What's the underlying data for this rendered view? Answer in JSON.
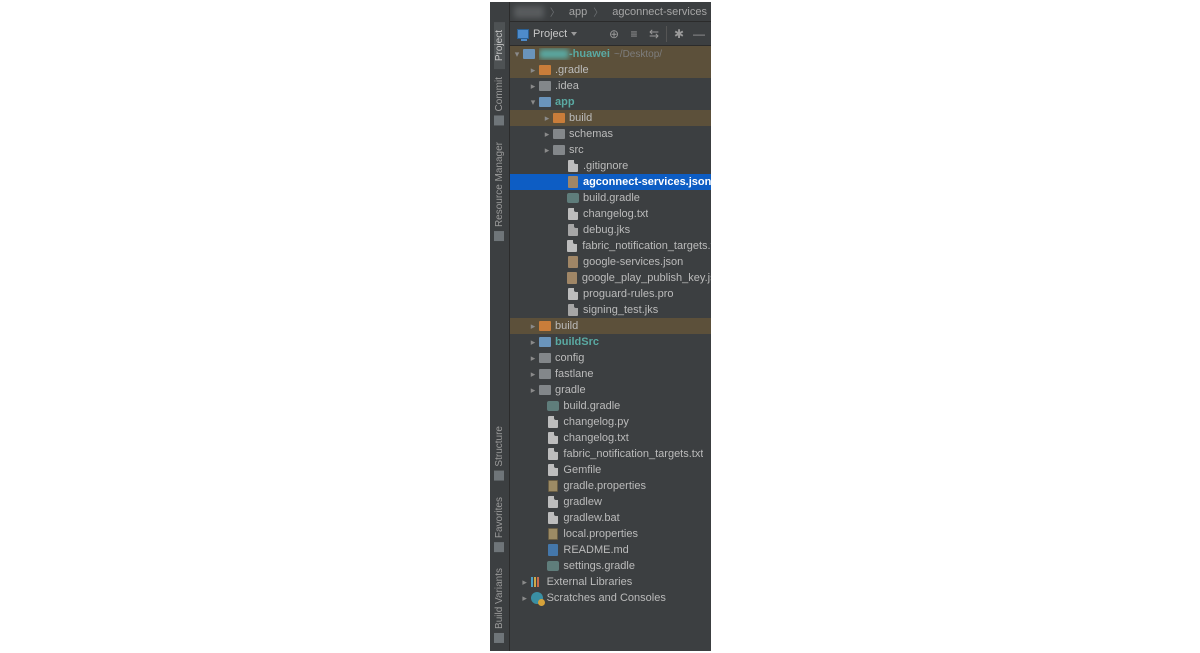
{
  "breadcrumb": {
    "items": [
      {
        "blurred": true,
        "label": ""
      },
      {
        "label": "app",
        "icon": "folder"
      },
      {
        "label": "agconnect-services",
        "icon": "json"
      }
    ]
  },
  "toolbar": {
    "selector_label": "Project"
  },
  "tree": {
    "root": {
      "label_blur": true,
      "suffix": "-huawei",
      "hint": "~/Desktop/"
    },
    "nodes": [
      {
        "depth": 1,
        "arrow": "right",
        "icon": "fold-orange",
        "label": ".gradle",
        "hl": "brown"
      },
      {
        "depth": 1,
        "arrow": "right",
        "icon": "fold-grey",
        "label": ".idea"
      },
      {
        "depth": 1,
        "arrow": "down",
        "icon": "fold-blue",
        "label": "app",
        "bold": true,
        "teal": true
      },
      {
        "depth": 2,
        "arrow": "right",
        "icon": "fold-orange",
        "label": "build",
        "hl": "brown"
      },
      {
        "depth": 2,
        "arrow": "right",
        "icon": "fold-grey",
        "label": "schemas"
      },
      {
        "depth": 2,
        "arrow": "right",
        "icon": "fold-grey",
        "label": "src"
      },
      {
        "depth": 3,
        "arrow": "",
        "icon": "file-txt",
        "label": ".gitignore"
      },
      {
        "depth": 3,
        "arrow": "",
        "icon": "json",
        "label": "agconnect-services.json",
        "bold": true,
        "selected": true
      },
      {
        "depth": 3,
        "arrow": "",
        "icon": "gradle",
        "label": "build.gradle"
      },
      {
        "depth": 3,
        "arrow": "",
        "icon": "file-txt",
        "label": "changelog.txt"
      },
      {
        "depth": 3,
        "arrow": "",
        "icon": "file-dark",
        "label": "debug.jks"
      },
      {
        "depth": 3,
        "arrow": "",
        "icon": "file-txt",
        "label": "fabric_notification_targets.txt"
      },
      {
        "depth": 3,
        "arrow": "",
        "icon": "json",
        "label": "google-services.json"
      },
      {
        "depth": 3,
        "arrow": "",
        "icon": "json",
        "label": "google_play_publish_key.json"
      },
      {
        "depth": 3,
        "arrow": "",
        "icon": "file-txt",
        "label": "proguard-rules.pro"
      },
      {
        "depth": 3,
        "arrow": "",
        "icon": "file-dark",
        "label": "signing_test.jks"
      },
      {
        "depth": 1,
        "arrow": "right",
        "icon": "fold-orange",
        "label": "build",
        "hl": "brown"
      },
      {
        "depth": 1,
        "arrow": "right",
        "icon": "fold-blue",
        "label": "buildSrc",
        "bold": true,
        "teal": true
      },
      {
        "depth": 1,
        "arrow": "right",
        "icon": "fold-grey",
        "label": "config"
      },
      {
        "depth": 1,
        "arrow": "right",
        "icon": "fold-grey",
        "label": "fastlane"
      },
      {
        "depth": 1,
        "arrow": "right",
        "icon": "fold-grey",
        "label": "gradle"
      },
      {
        "depth": 2,
        "arrow": "",
        "icon": "gradle",
        "label": "build.gradle",
        "depthOverride": 1.6
      },
      {
        "depth": 2,
        "arrow": "",
        "icon": "file-txt",
        "label": "changelog.py",
        "depthOverride": 1.6
      },
      {
        "depth": 2,
        "arrow": "",
        "icon": "file-txt",
        "label": "changelog.txt",
        "depthOverride": 1.6
      },
      {
        "depth": 2,
        "arrow": "",
        "icon": "file-txt",
        "label": "fabric_notification_targets.txt",
        "depthOverride": 1.6
      },
      {
        "depth": 2,
        "arrow": "",
        "icon": "file-txt",
        "label": "Gemfile",
        "depthOverride": 1.6
      },
      {
        "depth": 2,
        "arrow": "",
        "icon": "prop",
        "label": "gradle.properties",
        "depthOverride": 1.6
      },
      {
        "depth": 2,
        "arrow": "",
        "icon": "file-txt",
        "label": "gradlew",
        "depthOverride": 1.6
      },
      {
        "depth": 2,
        "arrow": "",
        "icon": "file-txt",
        "label": "gradlew.bat",
        "depthOverride": 1.6
      },
      {
        "depth": 2,
        "arrow": "",
        "icon": "prop",
        "label": "local.properties",
        "depthOverride": 1.6
      },
      {
        "depth": 2,
        "arrow": "",
        "icon": "md",
        "label": "README.md",
        "depthOverride": 1.6
      },
      {
        "depth": 2,
        "arrow": "",
        "icon": "gradle",
        "label": "settings.gradle",
        "depthOverride": 1.6
      },
      {
        "depth": 0,
        "arrow": "right",
        "icon": "lib",
        "label": "External Libraries",
        "depthOverride": 0.4
      },
      {
        "depth": 0,
        "arrow": "right",
        "icon": "scr",
        "label": "Scratches and Consoles",
        "depthOverride": 0.4
      }
    ]
  },
  "sidetabs": [
    {
      "label": "Project",
      "active": true
    },
    {
      "label": "Commit"
    },
    {
      "label": "Resource Manager"
    },
    {
      "label": "Structure"
    },
    {
      "label": "Favorites"
    },
    {
      "label": "Build Variants"
    }
  ]
}
